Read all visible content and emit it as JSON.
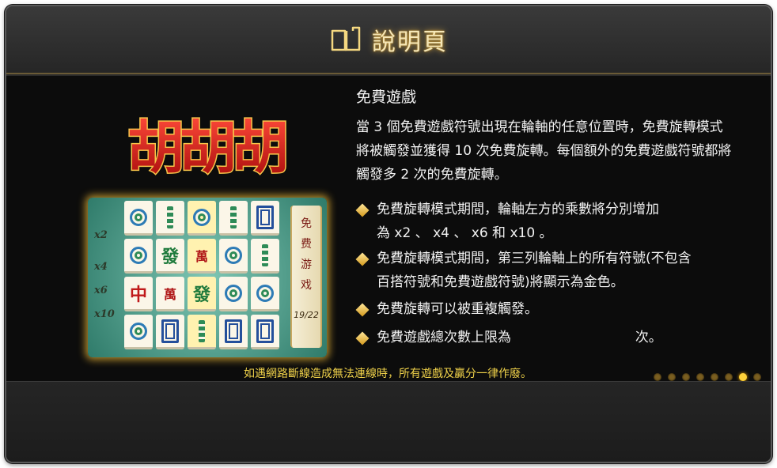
{
  "header": {
    "title": "說明頁",
    "icon": "book-icon"
  },
  "logo": {
    "text": "胡胡胡"
  },
  "preview": {
    "multipliers": [
      "x2",
      "x4",
      "x6",
      "x10"
    ],
    "scroll_text": [
      "免",
      "费",
      "游",
      "戏"
    ],
    "scroll_count": "19/22"
  },
  "section": {
    "heading": "免費遊戲",
    "description": "當 3 個免費遊戲符號出現在輪軸的任意位置時，免費旋轉模式將被觸發並獲得 10 次免費旋轉。每個額外的免費遊戲符號都將觸發多 2 次的免費旋轉。",
    "bullets": [
      {
        "line1": "免費旋轉模式期間，輪軸左方的乘數將分別增加",
        "line2": "為 x2 、 x4 、 x6 和 x10 。"
      },
      {
        "line1": "免費旋轉模式期間，第三列輪軸上的所有符號(不包含",
        "line2": "百搭符號和免費遊戲符號)將顯示為金色。"
      },
      {
        "line1": "免費旋轉可以被重複觸發。",
        "line2": ""
      },
      {
        "line1": "免費遊戲總次數上限為",
        "line2": "次。"
      }
    ]
  },
  "footer_notice": "如遇網路斷線造成無法連線時，所有遊戲及贏分一律作廢。",
  "pagination": {
    "total": 8,
    "active_index": 6
  },
  "colors": {
    "gold": "#f0d24a",
    "accent": "#ffd23a",
    "text": "#f2f2f2"
  }
}
